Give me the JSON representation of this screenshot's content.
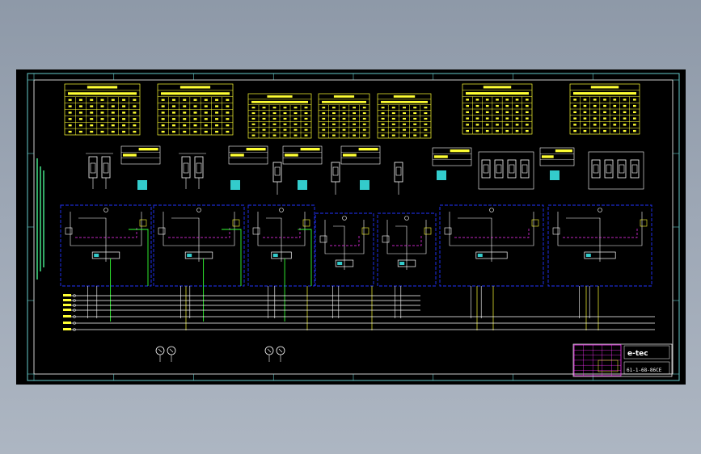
{
  "viewport": {
    "background": "#000000",
    "page_bg": "#9aa4b2"
  },
  "drawing": {
    "id_text": "61-1-68-86CE",
    "logo_text": "e-tec"
  },
  "colors": {
    "yellow": "#ffff33",
    "white": "#ffffff",
    "cyan": "#33cccc",
    "blue": "#2233ff",
    "green": "#33ff33",
    "magenta": "#ff33ff",
    "teal_frame": "#66cccc",
    "red": "#ff3333"
  },
  "icons": [
    "gauge-icon",
    "pump-icon",
    "valve-icon",
    "cylinder-icon"
  ]
}
